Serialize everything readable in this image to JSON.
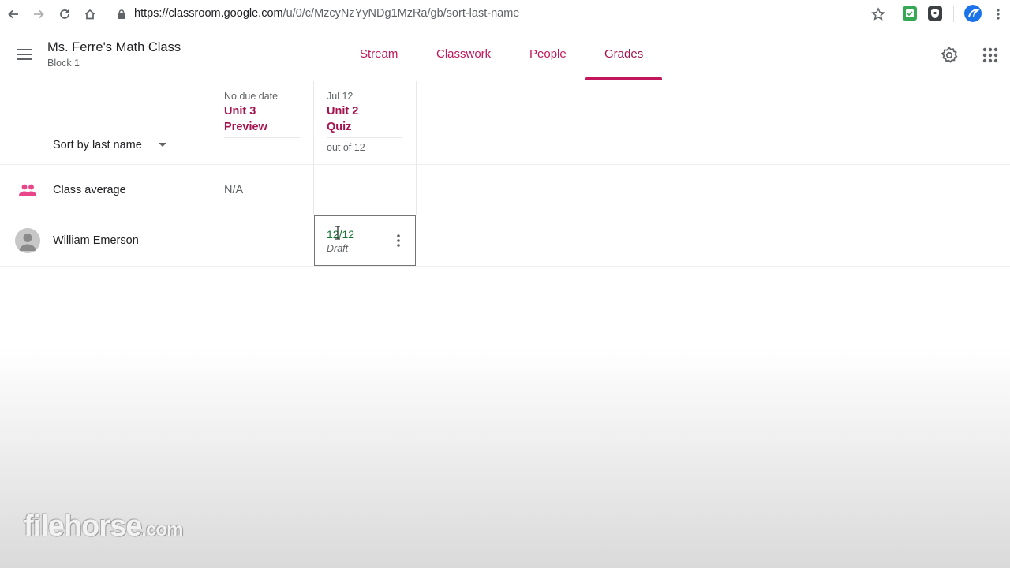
{
  "browser": {
    "url_host": "https://classroom.google.com",
    "url_path": "/u/0/c/MzcyNzYyNDg1MzRa/gb/sort-last-name"
  },
  "header": {
    "class_name": "Ms. Ferre's Math Class",
    "section": "Block 1",
    "tabs": [
      {
        "label": "Stream"
      },
      {
        "label": "Classwork"
      },
      {
        "label": "People"
      },
      {
        "label": "Grades"
      }
    ],
    "active_tab": "Grades",
    "accent_color": "#c2185b"
  },
  "gradebook": {
    "sort_label": "Sort by last name",
    "assignments": [
      {
        "due": "No due date",
        "title_line1": "Unit 3",
        "title_line2": "Preview",
        "points": ""
      },
      {
        "due": "Jul 12",
        "title_line1": "Unit 2",
        "title_line2": "Quiz",
        "points": "out of 12"
      }
    ],
    "class_average": {
      "label": "Class average",
      "values": [
        "N/A",
        ""
      ]
    },
    "students": [
      {
        "name": "William Emerson",
        "grades": [
          "",
          "12/12"
        ],
        "status": "Draft"
      }
    ]
  },
  "watermark": {
    "brand": "filehorse",
    "suffix": ".com"
  }
}
